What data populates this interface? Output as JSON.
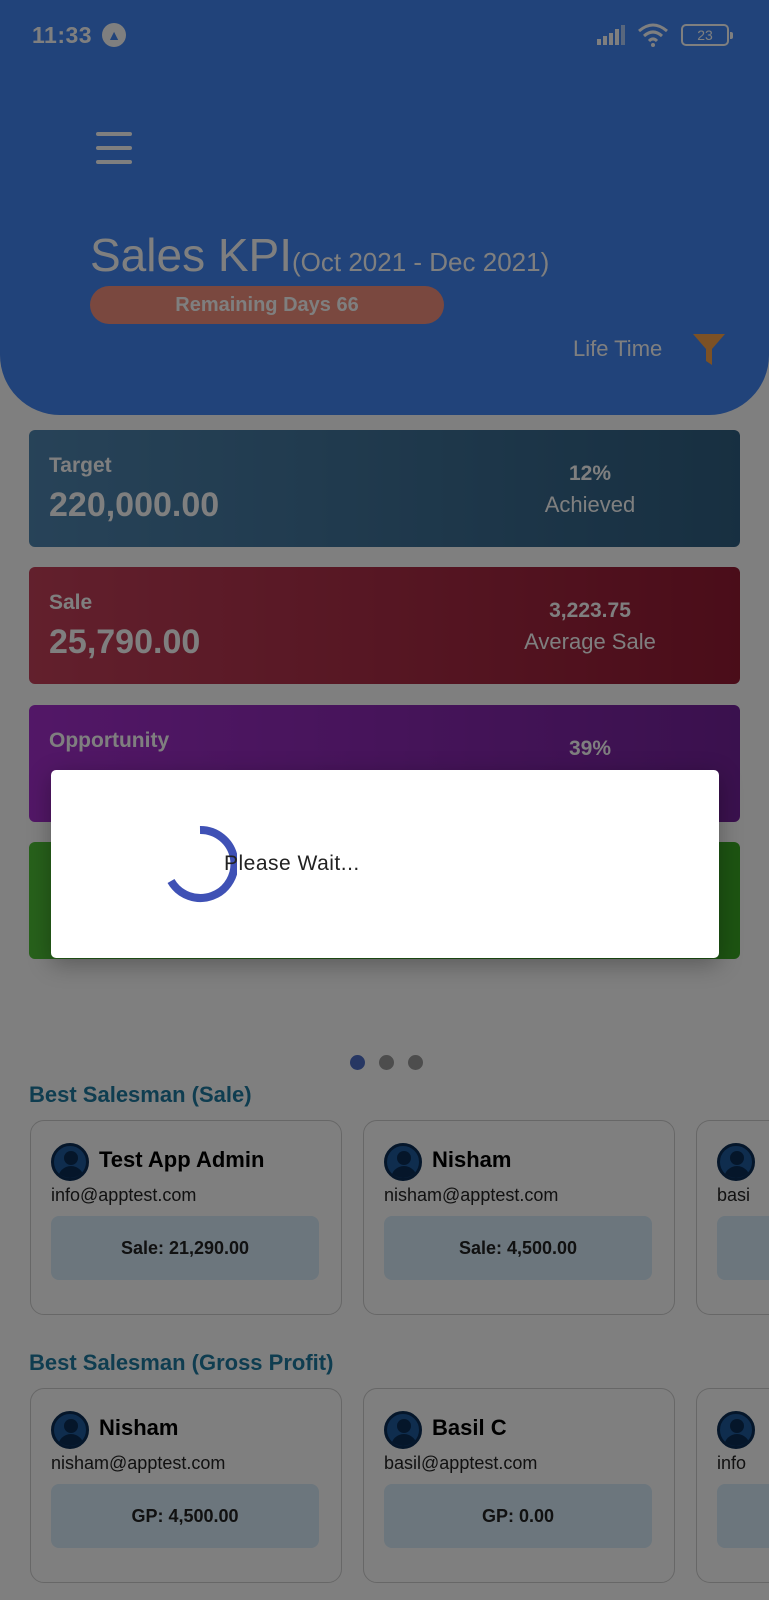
{
  "status_bar": {
    "time": "11:33",
    "nav_icon": "navigation-arrow-icon",
    "battery": "23"
  },
  "header": {
    "title": "Sales KPI",
    "subtitle": "(Oct 2021 - Dec 2021)",
    "remaining_days": "Remaining Days 66",
    "period_label": "Life Time",
    "accent": "#4286f4",
    "filter_color": "#f8a24b"
  },
  "kpis": [
    {
      "label": "Target",
      "value": "220,000.00",
      "right_value": "12%",
      "right_label": "Achieved"
    },
    {
      "label": "Sale",
      "value": "25,790.00",
      "right_value": "3,223.75",
      "right_label": "Average Sale"
    },
    {
      "label": "Opportunity",
      "value": "",
      "right_value": "39%",
      "right_label": ""
    },
    {
      "label": "",
      "value": "",
      "right_value": "",
      "right_label": ""
    }
  ],
  "pager": {
    "active": 0,
    "count": 3
  },
  "best_sale": {
    "title": "Best Salesman (Sale)",
    "cards": [
      {
        "name": "Test App Admin",
        "email": "info@apptest.com",
        "stat": "Sale: 21,290.00"
      },
      {
        "name": "Nisham",
        "email": "nisham@apptest.com",
        "stat": "Sale: 4,500.00"
      },
      {
        "name": "",
        "email": "basi",
        "stat": ""
      }
    ]
  },
  "best_gp": {
    "title": "Best Salesman (Gross Profit)",
    "cards": [
      {
        "name": "Nisham",
        "email": "nisham@apptest.com",
        "stat": "GP: 4,500.00"
      },
      {
        "name": "Basil C",
        "email": "basil@apptest.com",
        "stat": "GP: 0.00"
      },
      {
        "name": "",
        "email": "info",
        "stat": ""
      }
    ]
  },
  "dialog": {
    "message": "Please Wait...",
    "spinner_color": "#3f51b5"
  }
}
